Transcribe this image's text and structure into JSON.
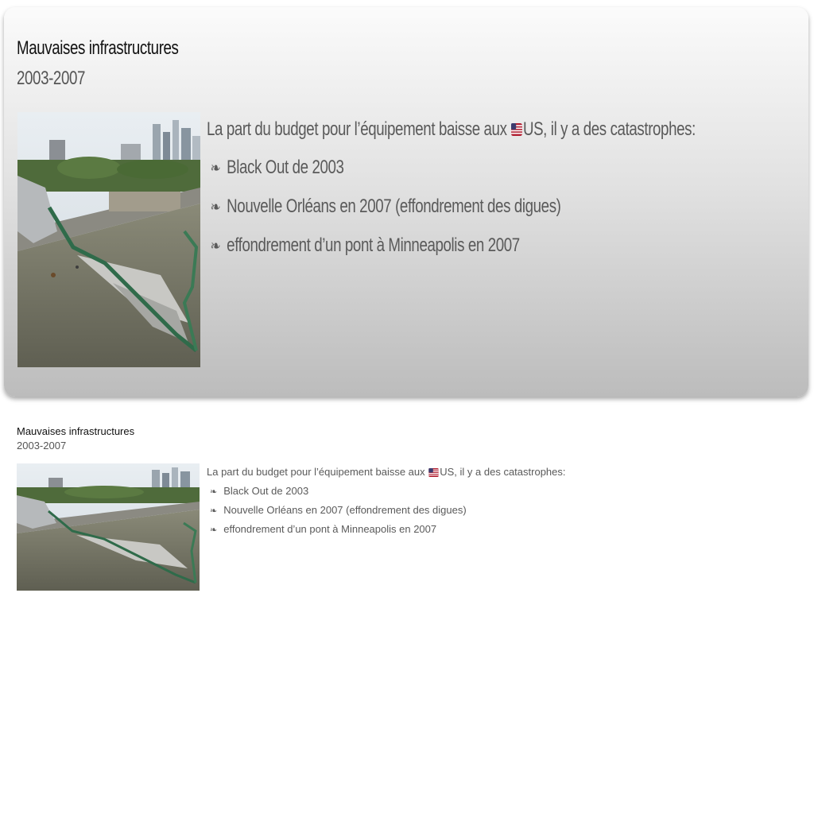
{
  "slide": {
    "title": "Mauvaises infrastructures",
    "subtitle": "2003-2007",
    "intro_before_flag": "La part du budget pour l’équipement baisse aux ",
    "intro_after_flag": "US, il y a des catastrophes:",
    "flag_icon": "us-flag-icon",
    "bullet_glyph": "❧",
    "items": [
      "Black Out de 2003",
      "Nouvelle Orléans en 2007 (effondrement des digues)",
      "effondrement d’un pont à Minneapolis en 2007"
    ],
    "image": "collapsed-bridge-photo"
  },
  "colors": {
    "title": "#111111",
    "text": "#5a5a5a",
    "card_top": "#fbfbfb",
    "card_bottom": "#bcbcbc"
  }
}
